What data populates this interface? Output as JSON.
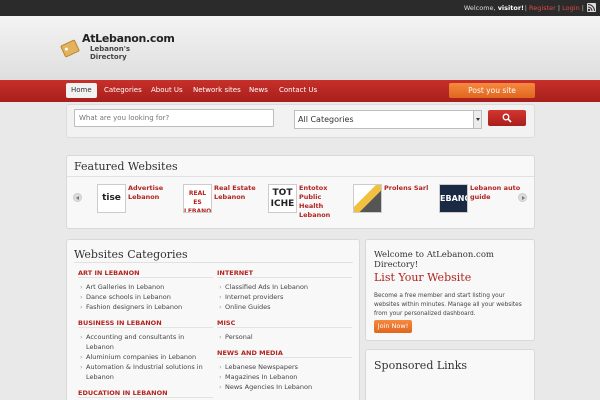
{
  "topbar": {
    "welcome_prefix": "Welcome, ",
    "user": "visitor!",
    "register": "Register",
    "separator": "|",
    "login": "Login",
    "rss_icon": "rss-icon"
  },
  "logo": {
    "name": "AtLebanon.com",
    "subtitle": "Lebanon's Directory"
  },
  "nav": {
    "items": [
      "Home",
      "Categories",
      "About Us",
      "Network sites",
      "News",
      "Contact Us"
    ],
    "post_button": "Post you site"
  },
  "search": {
    "placeholder": "What are you looking for?",
    "category_selected": "All Categories",
    "button_icon": "search-icon"
  },
  "featured": {
    "title": "Featured Websites",
    "items": [
      {
        "name": "Advertise Lebanon",
        "thumb": "tise ↓"
      },
      {
        "name": "Real Estate Lebanon",
        "thumb": "REAL ES LEBANO"
      },
      {
        "name": "Entotox Public Health Lebanon",
        "thumb": "TOT ICHE"
      },
      {
        "name": "Prolens Sarl",
        "thumb": ""
      },
      {
        "name": "Lebanon auto guide",
        "thumb": "EBANO"
      }
    ]
  },
  "categories": {
    "title": "Websites Categories",
    "left": [
      {
        "name": "ART IN LEBANON",
        "subs": [
          "Art Galleries In Lebanon",
          "Dance schools in Lebanon",
          "Fashion designers in Lebanon"
        ]
      },
      {
        "name": "BUSINESS IN LEBANON",
        "subs": [
          "Accounting and consultants in Lebanon",
          "Aluminium companies in Lebanon",
          "Automation & Industrial solutions in Lebanon"
        ]
      },
      {
        "name": "EDUCATION IN LEBANON",
        "subs": []
      }
    ],
    "right": [
      {
        "name": "INTERNET",
        "subs": [
          "Classified Ads In Lebanon",
          "Internet providers",
          "Online Guides"
        ]
      },
      {
        "name": "MISC",
        "subs": [
          "Personal"
        ]
      },
      {
        "name": "NEWS AND MEDIA",
        "subs": [
          "Lebanese Newspapers",
          "Magazines In Lebanon",
          "News Agencies In Lebanon"
        ]
      }
    ]
  },
  "welcome": {
    "title": "Welcome to AtLebanon.com Directory!",
    "list_title": "List Your Website",
    "description": "Become a free member and start listing your websites within minutes. Manage all your websites from your personalized dashboard.",
    "join_button": "Join Now!"
  },
  "sponsored": {
    "title": "Sponsored Links"
  }
}
